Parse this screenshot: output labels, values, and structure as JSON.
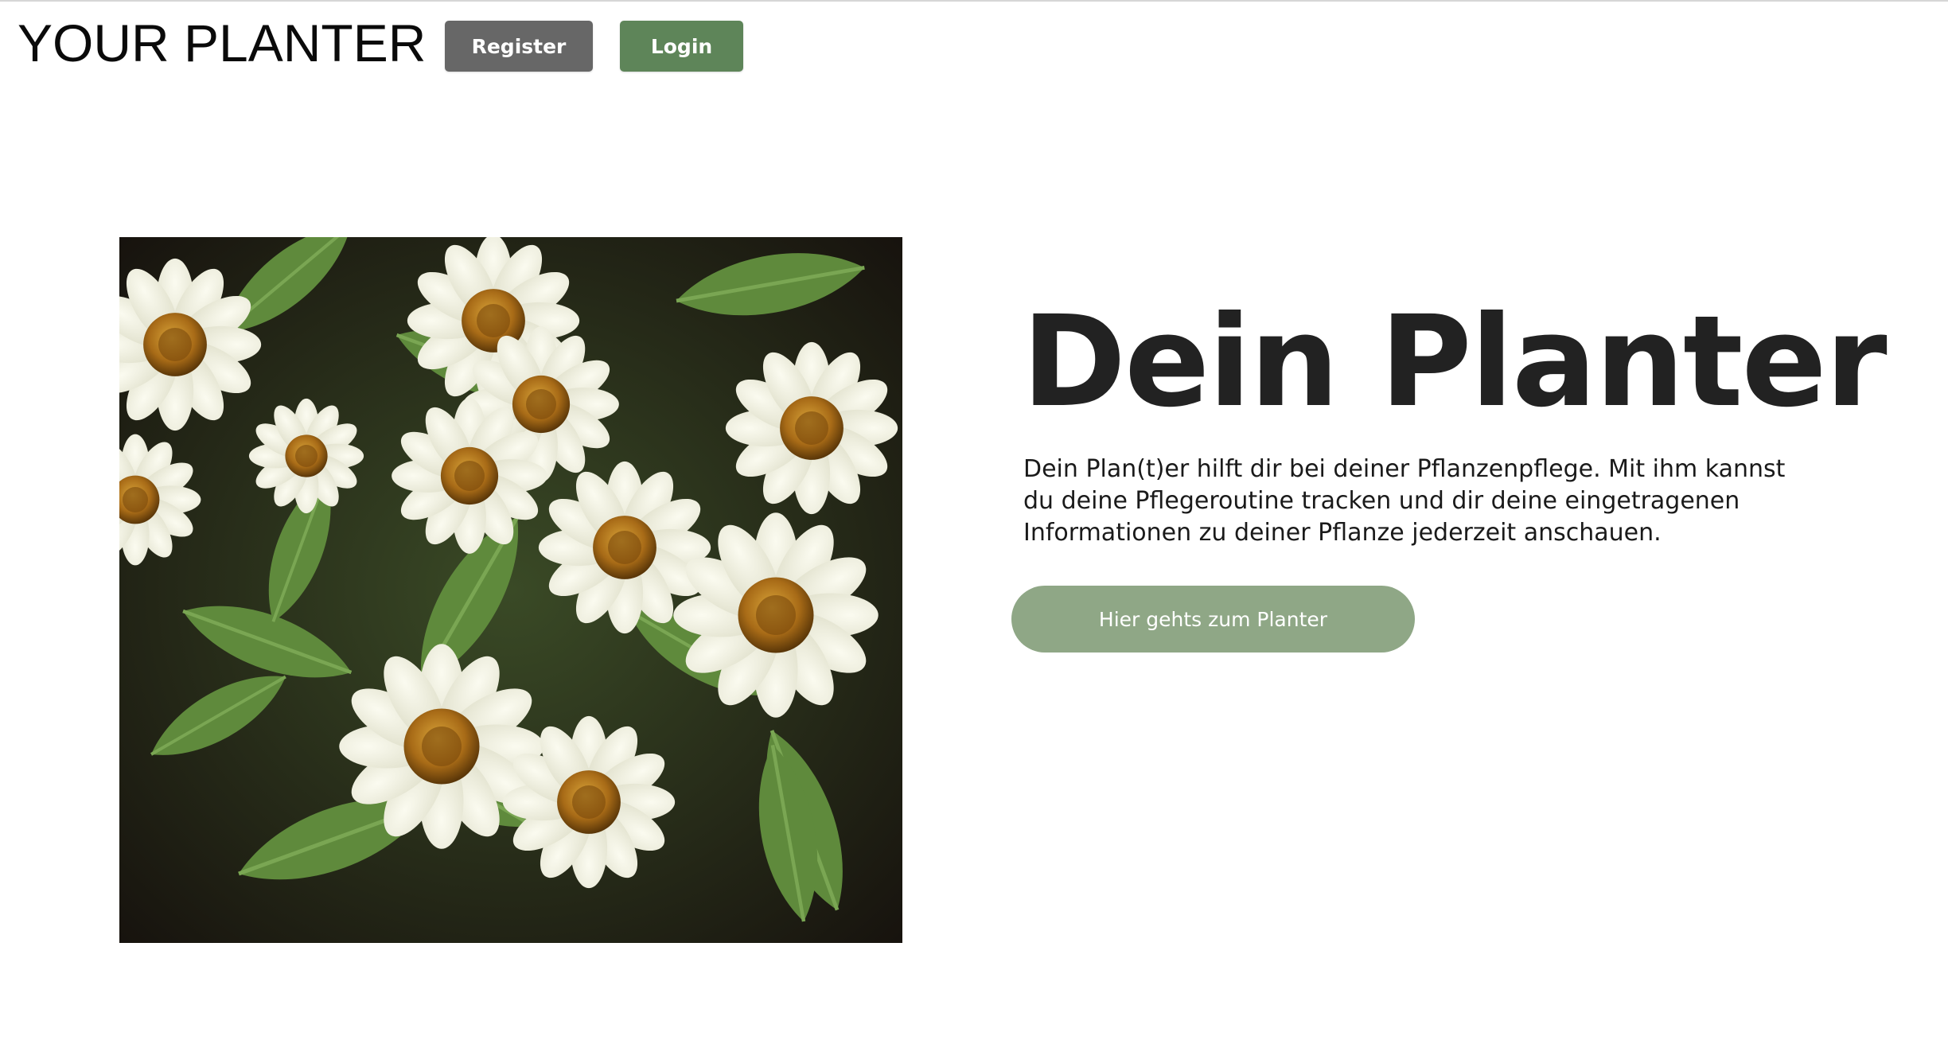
{
  "header": {
    "brand": "YOUR PLANTER",
    "register_label": "Register",
    "login_label": "Login"
  },
  "hero": {
    "image_icon": "flowers-photo",
    "title": "Dein Planter",
    "text": "Dein Plan(t)er hilft dir bei deiner Pflanzenpflege. Mit ihm kannst du deine Pflegeroutine tracken und dir deine eingetragenen Informationen zu deiner Pflanze jederzeit anschauen.",
    "cta_label": "Hier gehts zum Planter"
  },
  "colors": {
    "register_bg": "#676767",
    "login_bg": "#5e8559",
    "cta_bg": "#8fa786",
    "title": "#222222"
  }
}
